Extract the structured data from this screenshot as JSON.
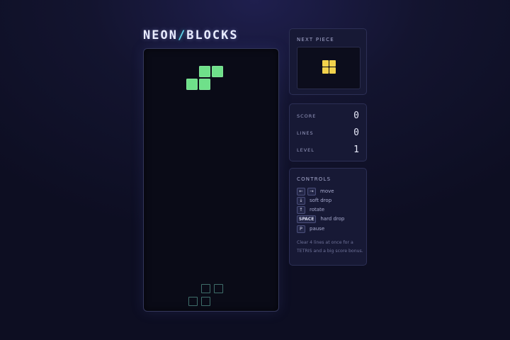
{
  "title": {
    "prefix": "NEON",
    "slash": "/",
    "suffix": "BLOCKS"
  },
  "board": {
    "columns": 10,
    "rows": 20,
    "active_piece": {
      "type": "S",
      "color": "#6fe08a",
      "cells": [
        [
          4,
          1
        ],
        [
          5,
          1
        ],
        [
          3,
          2
        ],
        [
          4,
          2
        ]
      ]
    },
    "ghost_piece": {
      "color": "#3f6e6a",
      "cells": [
        [
          4,
          18
        ],
        [
          5,
          18
        ],
        [
          3,
          19
        ],
        [
          4,
          19
        ]
      ]
    }
  },
  "next_piece": {
    "label": "NEXT PIECE",
    "type": "O",
    "color": "#f2d24c"
  },
  "stats": {
    "score_label": "SCORE",
    "score": "0",
    "lines_label": "LINES",
    "lines": "0",
    "level_label": "LEVEL",
    "level": "1"
  },
  "controls": {
    "title": "CONTROLS",
    "items": [
      {
        "keys": [
          "←",
          "→"
        ],
        "label": "move"
      },
      {
        "keys": [
          "↓"
        ],
        "label": "soft drop"
      },
      {
        "keys": [
          "↑"
        ],
        "label": "rotate"
      },
      {
        "keys": [
          "SPACE"
        ],
        "label": "hard drop"
      },
      {
        "keys": [
          "P"
        ],
        "label": "pause"
      }
    ],
    "hint": "Clear 4 lines at once for a TETRIS and a big score bonus."
  },
  "colors": {
    "accent": "#5fd7ee",
    "background": "#13142f"
  }
}
